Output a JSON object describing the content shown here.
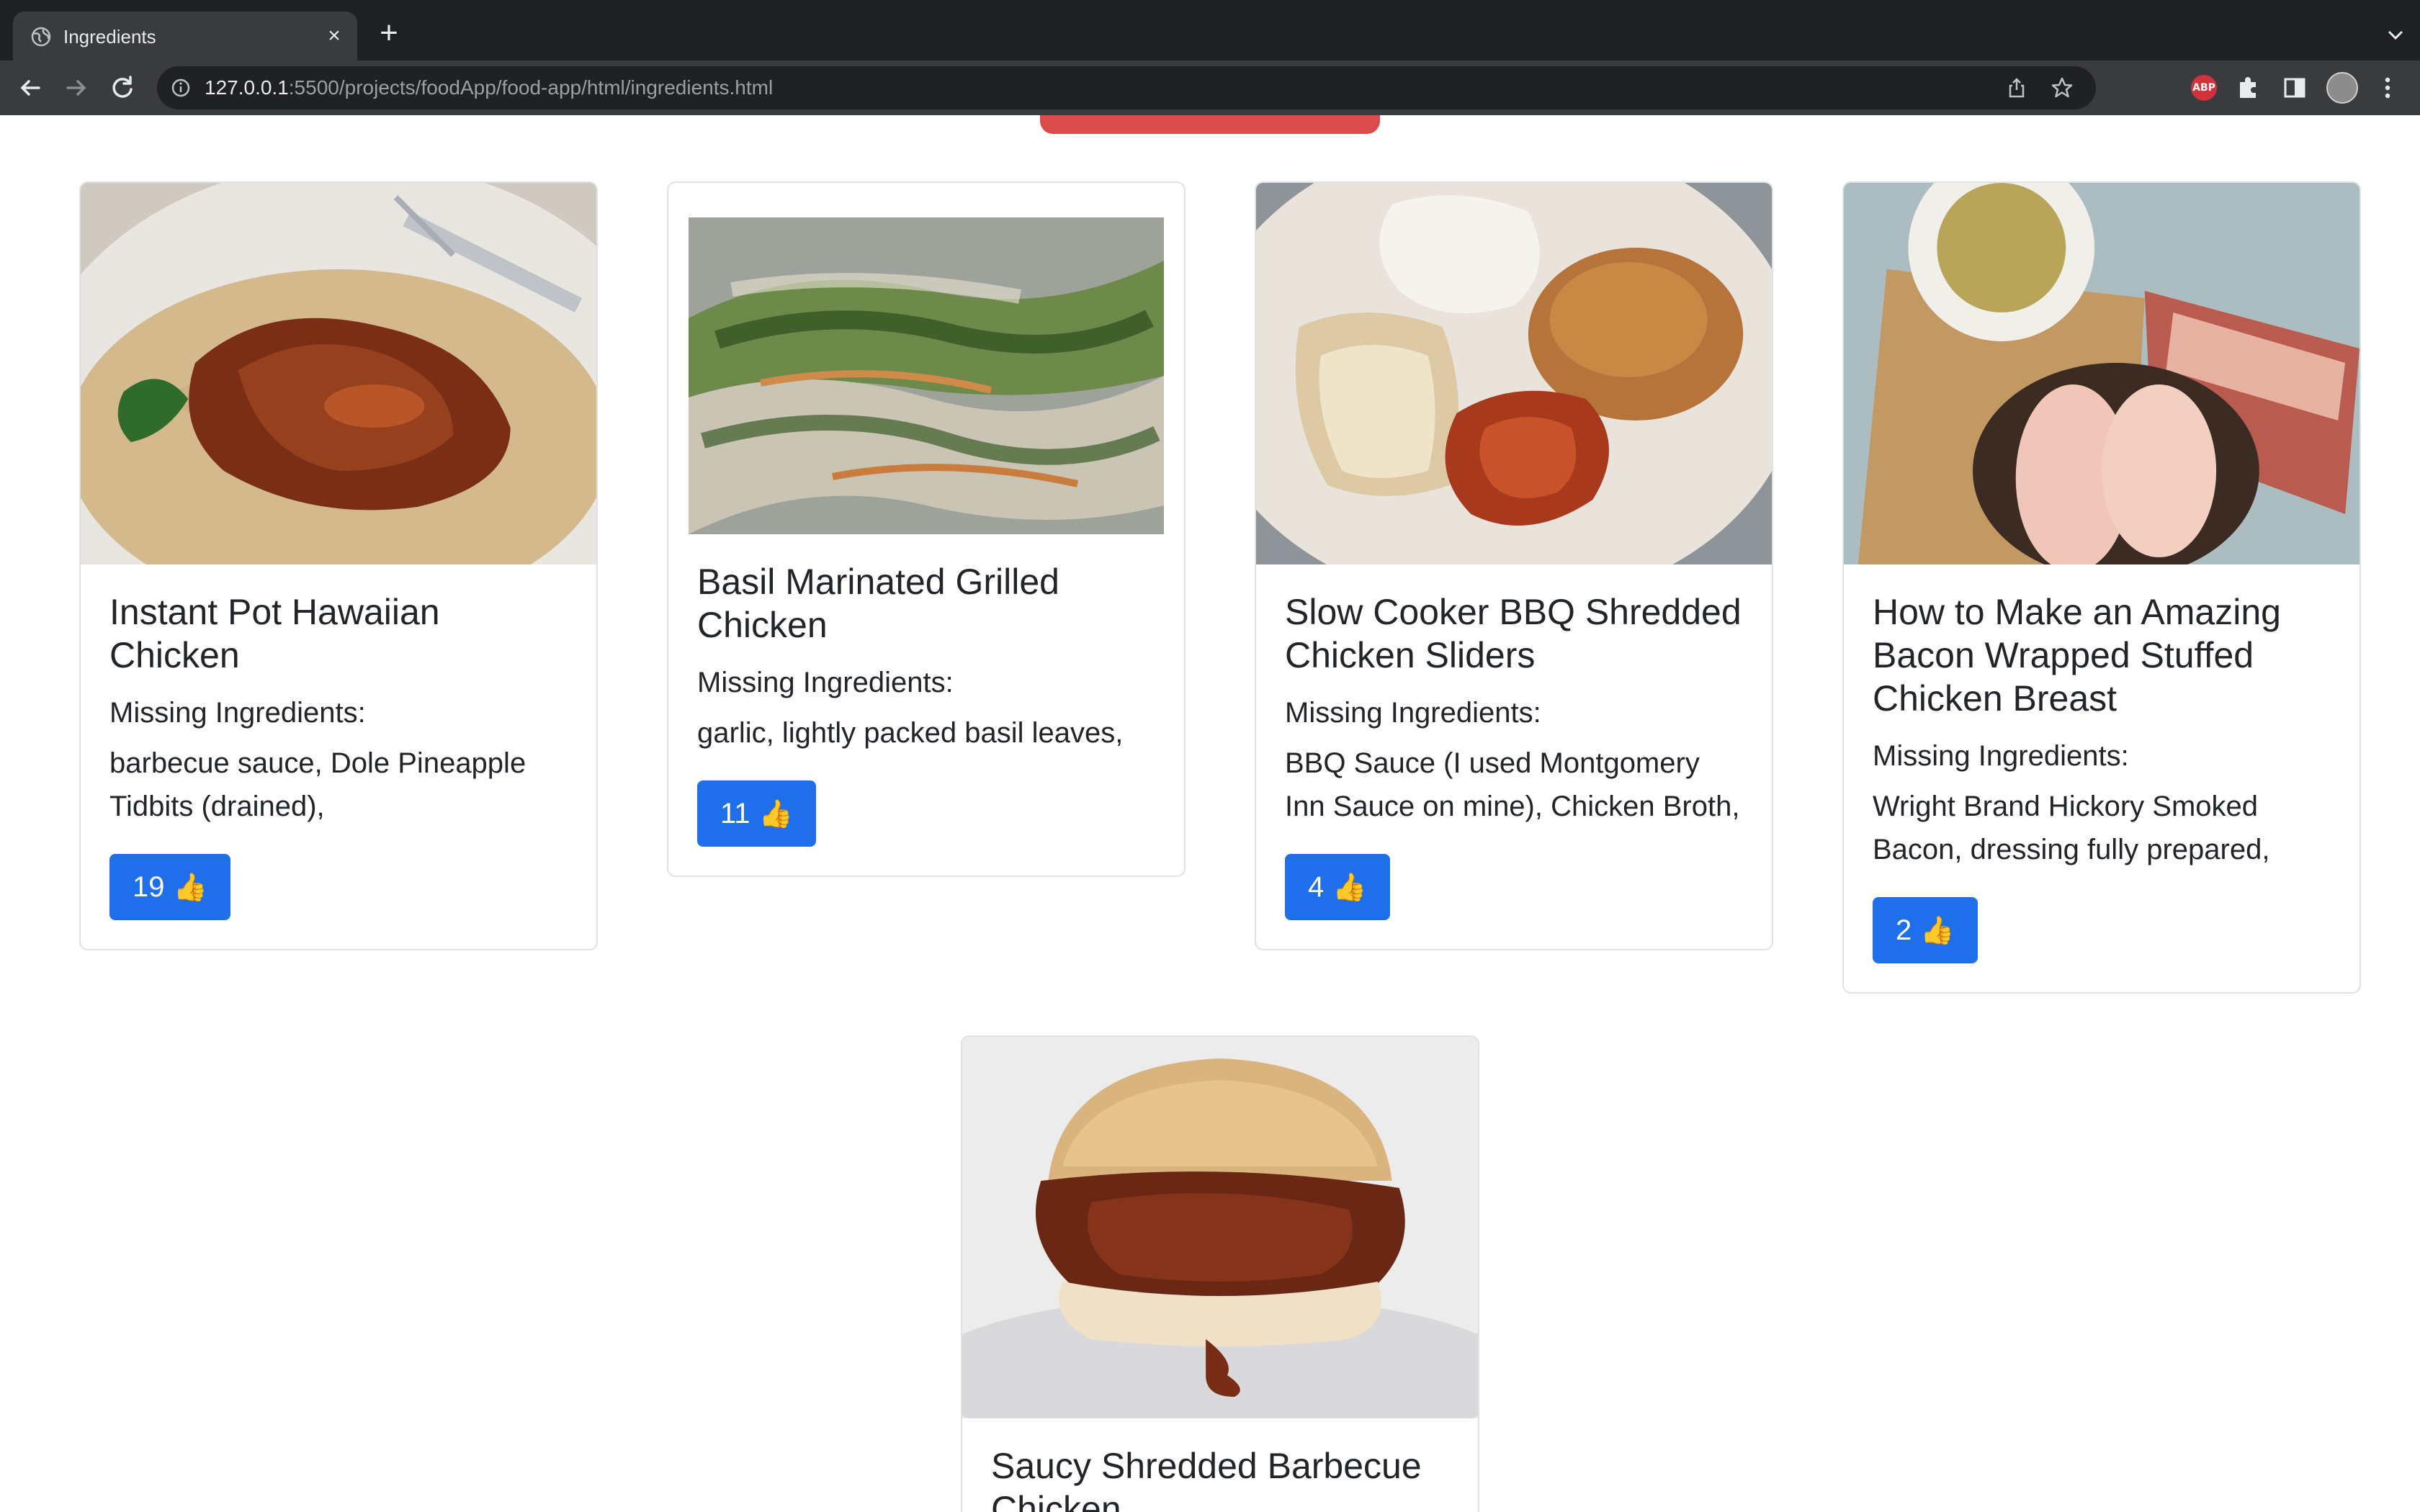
{
  "browser": {
    "tab_title": "Ingredients",
    "url_host": "127.0.0.1",
    "url_rest": ":5500/projects/foodApp/food-app/html/ingredients.html",
    "extension_badge": "ABP"
  },
  "recipes": [
    {
      "title": "Instant Pot Hawaiian Chicken",
      "missing_label": "Missing Ingredients:",
      "ingredients": "barbecue sauce, Dole Pineapple Tidbits (drained),",
      "likes": "19",
      "thumb": "👍"
    },
    {
      "title": "Basil Marinated Grilled Chicken",
      "missing_label": "Missing Ingredients:",
      "ingredients": "garlic, lightly packed basil leaves,",
      "likes": "11",
      "thumb": "👍"
    },
    {
      "title": "Slow Cooker BBQ Shredded Chicken Sliders",
      "missing_label": "Missing Ingredients:",
      "ingredients": "BBQ Sauce (I used Montgomery Inn Sauce on mine), Chicken Broth,",
      "likes": "4",
      "thumb": "👍"
    },
    {
      "title": "How to Make an Amazing Bacon Wrapped Stuffed Chicken Breast",
      "missing_label": "Missing Ingredients:",
      "ingredients": "Wright Brand Hickory Smoked Bacon, dressing fully prepared,",
      "likes": "2",
      "thumb": "👍"
    },
    {
      "title": "Saucy Shredded Barbecue Chicken"
    }
  ]
}
